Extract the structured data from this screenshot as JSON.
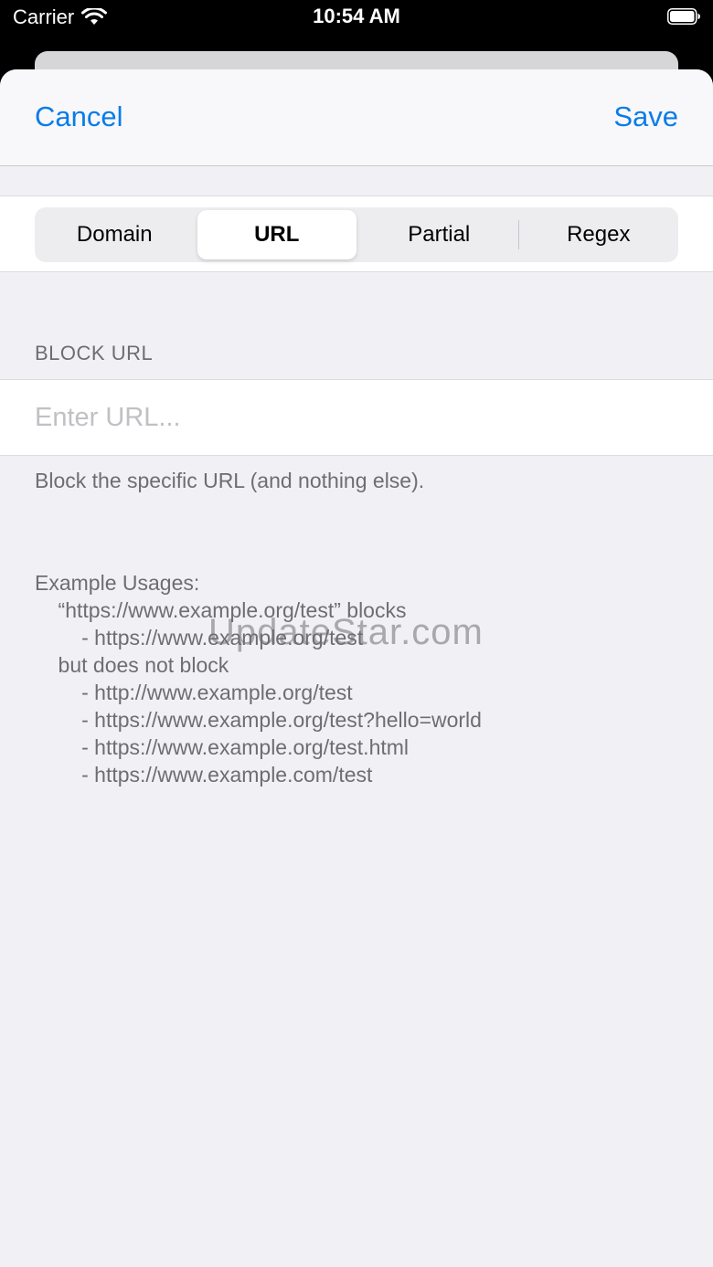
{
  "status_bar": {
    "carrier": "Carrier",
    "time": "10:54 AM"
  },
  "nav": {
    "cancel_label": "Cancel",
    "save_label": "Save"
  },
  "segments": [
    {
      "label": "Domain"
    },
    {
      "label": "URL"
    },
    {
      "label": "Partial"
    },
    {
      "label": "Regex"
    }
  ],
  "selected_segment": "URL",
  "section": {
    "header": "BLOCK URL",
    "input_placeholder": "Enter URL...",
    "input_value": "",
    "footer": "Block the specific URL (and nothing else)."
  },
  "examples": {
    "lines": [
      "Example Usages:",
      "    “https://www.example.org/test” blocks",
      "        - https://www.example.org/test",
      "    but does not block",
      "        - http://www.example.org/test",
      "        - https://www.example.org/test?hello=world",
      "        - https://www.example.org/test.html",
      "        - https://www.example.com/test"
    ]
  },
  "watermark": "UpdateStar.com",
  "colors": {
    "accent": "#0a7ce8",
    "background": "#f1f1f5",
    "secondary_text": "#6d6d72"
  }
}
